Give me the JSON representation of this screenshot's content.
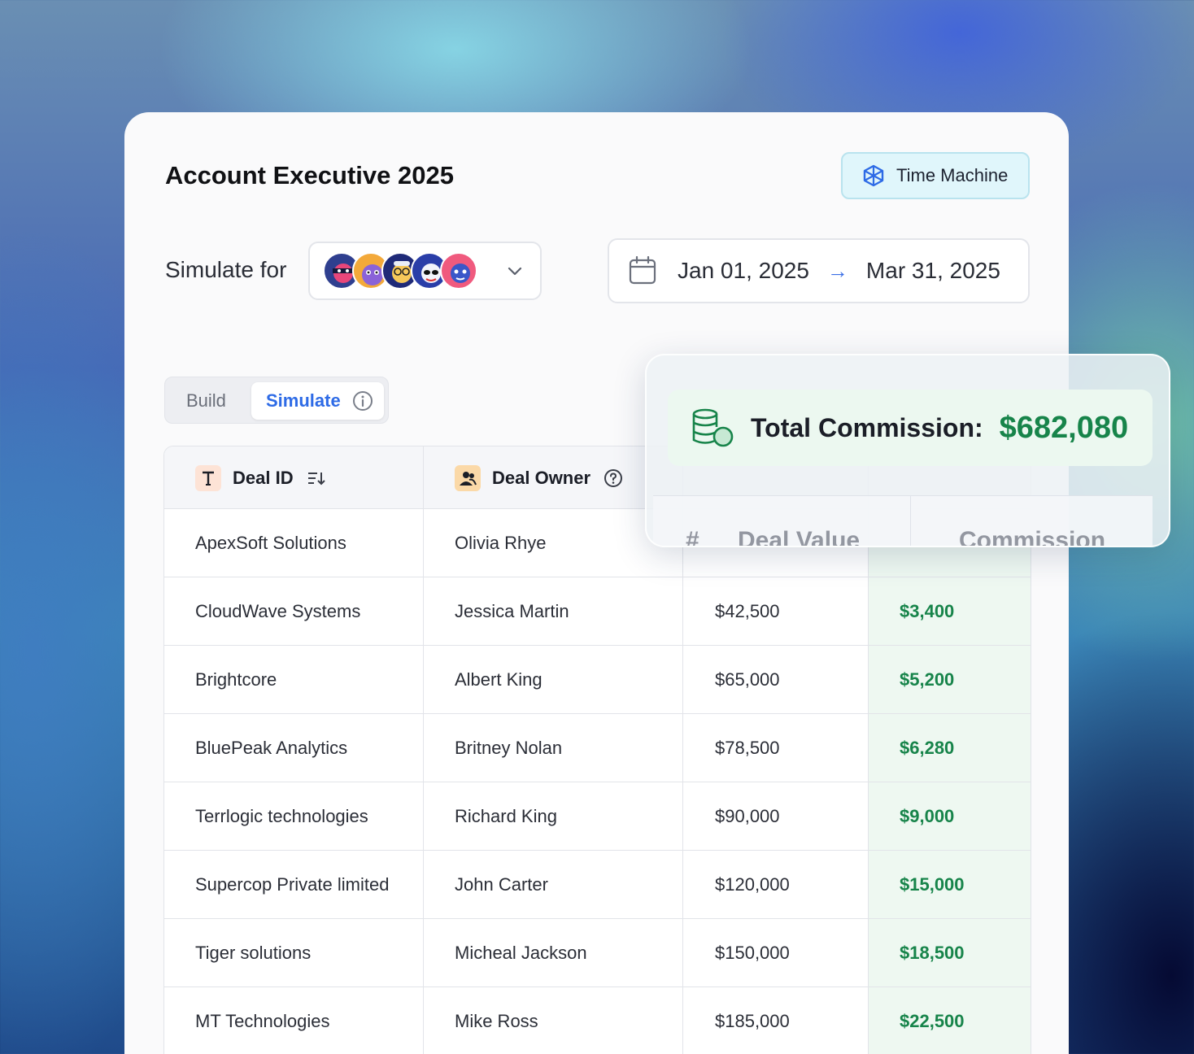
{
  "header": {
    "title": "Account Executive 2025",
    "time_machine_label": "Time Machine"
  },
  "simulate": {
    "label": "Simulate for",
    "avatars": [
      "avatar-1",
      "avatar-2",
      "avatar-3",
      "avatar-4",
      "avatar-5"
    ]
  },
  "date_range": {
    "start": "Jan 01, 2025",
    "arrow": "→",
    "end": "Mar 31, 2025"
  },
  "toggle": {
    "build_label": "Build",
    "simulate_label": "Simulate"
  },
  "summary": {
    "label": "Total Commission:",
    "value": "$682,080"
  },
  "table": {
    "columns": [
      {
        "label": "Deal ID",
        "icon": "text-type-icon"
      },
      {
        "label": "Deal Owner",
        "icon": "user-contact-icon"
      },
      {
        "label": "Deal Value",
        "icon": "hash-icon"
      },
      {
        "label": "Commission"
      }
    ],
    "rows": [
      {
        "deal": "ApexSoft Solutions",
        "owner": "Olivia Rhye",
        "value": "",
        "commission": ""
      },
      {
        "deal": "CloudWave Systems",
        "owner": "Jessica Martin",
        "value": "$42,500",
        "commission": "$3,400"
      },
      {
        "deal": "Brightcore",
        "owner": "Albert King",
        "value": "$65,000",
        "commission": "$5,200"
      },
      {
        "deal": "BluePeak Analytics",
        "owner": "Britney Nolan",
        "value": "$78,500",
        "commission": "$6,280"
      },
      {
        "deal": "Terrlogic technologies",
        "owner": "Richard King",
        "value": "$90,000",
        "commission": "$9,000"
      },
      {
        "deal": "Supercop Private limited",
        "owner": "John Carter",
        "value": "$120,000",
        "commission": "$15,000"
      },
      {
        "deal": "Tiger solutions",
        "owner": "Micheal Jackson",
        "value": "$150,000",
        "commission": "$18,500"
      },
      {
        "deal": "MT Technologies",
        "owner": "Mike Ross",
        "value": "$185,000",
        "commission": "$22,500"
      }
    ]
  },
  "colors": {
    "accent_blue": "#2e6be6",
    "commission_green": "#17844a"
  }
}
